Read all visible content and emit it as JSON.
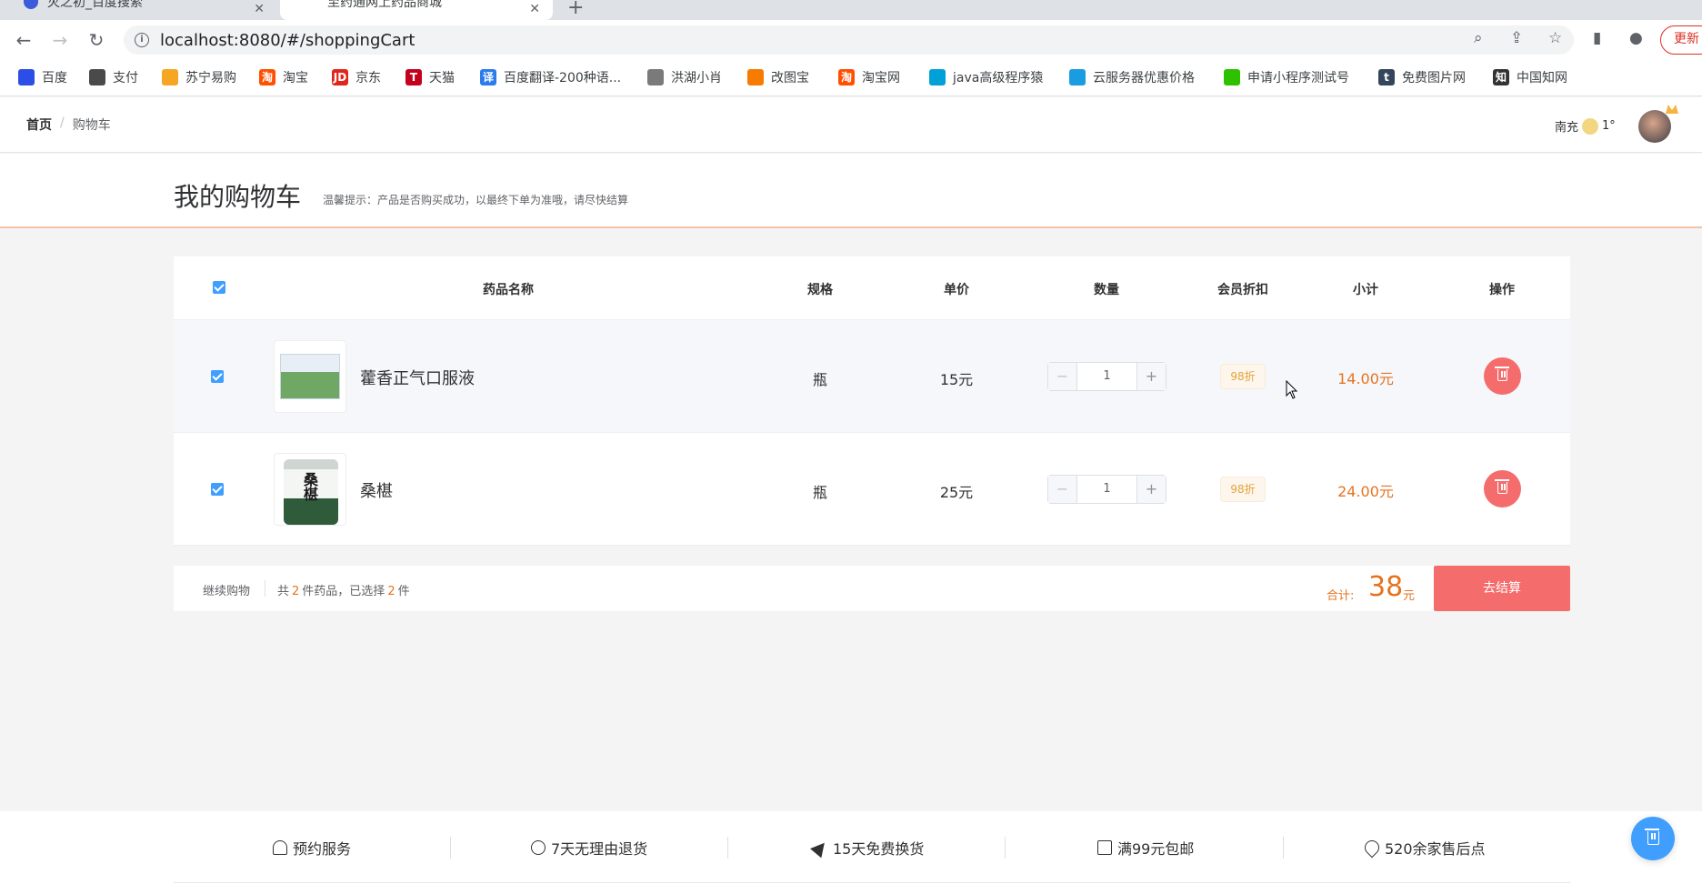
{
  "browser": {
    "tabs": [
      {
        "title": "灭之初_百度搜索"
      },
      {
        "title": "至药通网上药品商城"
      }
    ],
    "url": "localhost:8080/#/shoppingCart",
    "update_label": "更新",
    "bookmarks": [
      {
        "label": "百度",
        "icon": "baidu-icon",
        "color": "#2b4ee6"
      },
      {
        "label": "支付",
        "icon": "globe-icon",
        "color": "#4a4a4a"
      },
      {
        "label": "苏宁易购",
        "icon": "suning-icon",
        "color": "#f5a623"
      },
      {
        "label": "淘宝",
        "icon": "taobao-icon",
        "color": "#ff5000"
      },
      {
        "label": "京东",
        "icon": "jd-icon",
        "color": "#e1251b"
      },
      {
        "label": "天猫",
        "icon": "tmall-icon",
        "color": "#c4001f"
      },
      {
        "label": "百度翻译-200种语...",
        "icon": "translate-icon",
        "color": "#2b7bec"
      },
      {
        "label": "洪湖小肖",
        "icon": "bird-icon",
        "color": "#7a7a7a"
      },
      {
        "label": "改图宝",
        "icon": "image-icon",
        "color": "#f57c00"
      },
      {
        "label": "淘宝网",
        "icon": "taobao-icon",
        "color": "#ff5000"
      },
      {
        "label": "java高级程序猿",
        "icon": "bilibili-icon",
        "color": "#00a1d6"
      },
      {
        "label": "云服务器优惠价格",
        "icon": "cloud-icon",
        "color": "#1a9ce0"
      },
      {
        "label": "申请小程序测试号",
        "icon": "wechat-icon",
        "color": "#2dc100"
      },
      {
        "label": "免费图片网",
        "icon": "tumblr-icon",
        "color": "#35465c"
      },
      {
        "label": "中国知网",
        "icon": "cnki-icon",
        "color": "#333333"
      }
    ]
  },
  "header": {
    "breadcrumb_home": "首页",
    "breadcrumb_sep": "/",
    "breadcrumb_current": "购物车",
    "city": "南充",
    "temperature": "1°"
  },
  "cart": {
    "title": "我的购物车",
    "tip": "温馨提示：产品是否购买成功，以最终下单为准哦，请尽快结算",
    "columns": {
      "name": "药品名称",
      "spec": "规格",
      "price": "单价",
      "qty": "数量",
      "discount": "会员折扣",
      "subtotal": "小计",
      "action": "操作"
    },
    "items": [
      {
        "name": "藿香正气口服液",
        "spec": "瓶",
        "price": "15元",
        "qty": "1",
        "discount": "98折",
        "subtotal": "14.00元"
      },
      {
        "name": "桑椹",
        "spec": "瓶",
        "price": "25元",
        "qty": "1",
        "discount": "98折",
        "subtotal": "24.00元"
      }
    ],
    "stepper_minus": "−",
    "stepper_plus": "+",
    "footer": {
      "continue": "继续购物",
      "summary_prefix": "共",
      "count": "2",
      "summary_mid": "件药品，已选择",
      "selected": "2",
      "summary_suffix": "件",
      "total_label": "合计:",
      "total_value": "38",
      "total_unit": "元",
      "checkout": "去结算"
    },
    "thumb2_text": "桑椹"
  },
  "services": [
    {
      "label": "预约服务",
      "icon": "bell-icon"
    },
    {
      "label": "7天无理由退货",
      "icon": "clock-icon"
    },
    {
      "label": "15天免费换货",
      "icon": "send-icon"
    },
    {
      "label": "满99元包邮",
      "icon": "gift-icon"
    },
    {
      "label": "520余家售后点",
      "icon": "location-icon"
    }
  ],
  "colors": {
    "primary": "#409eff",
    "danger": "#f56c6c",
    "accent": "#e6731e",
    "warning": "#e6a23c"
  }
}
